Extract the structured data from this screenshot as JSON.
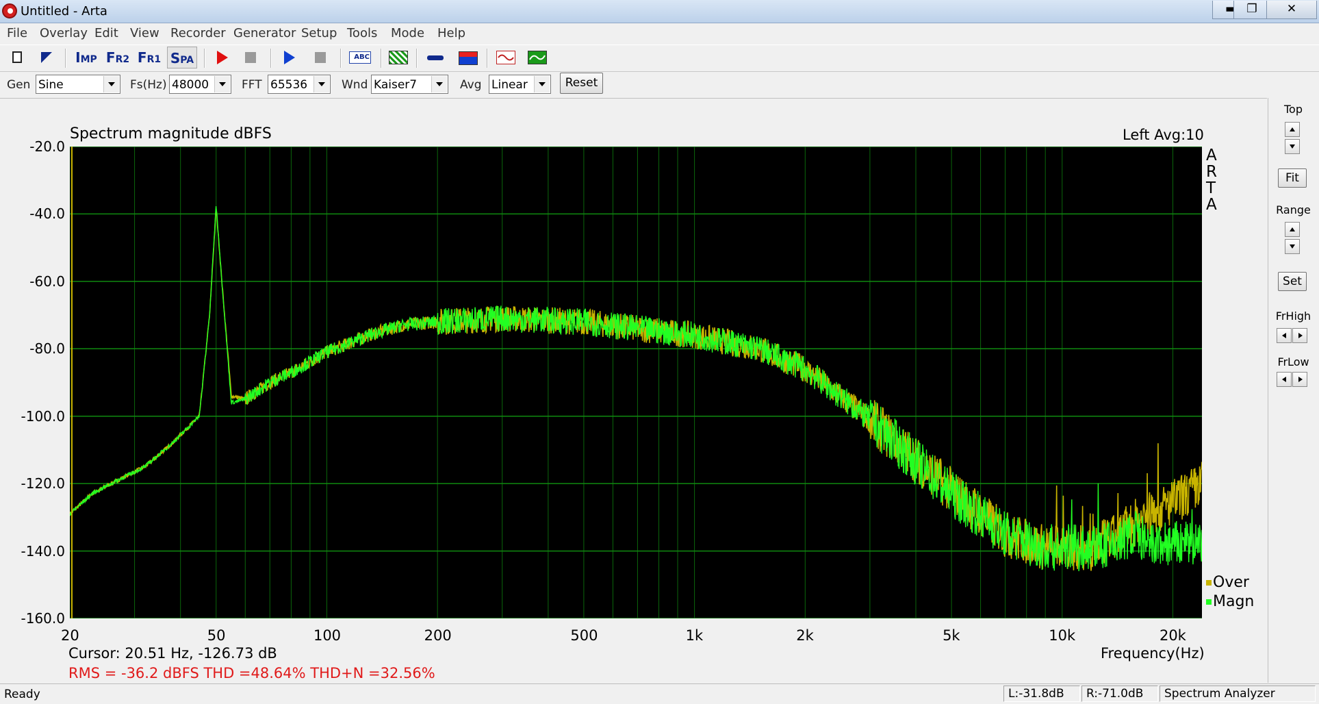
{
  "window": {
    "title": "Untitled - Arta",
    "minimize_glyph": "▬",
    "maximize_glyph": "❐",
    "close_glyph": "✕"
  },
  "menu": [
    "File",
    "Overlay",
    "Edit",
    "View",
    "Recorder",
    "Generator",
    "Setup",
    "Tools",
    "Mode",
    "Help"
  ],
  "toolbar": {
    "imp_label": "I",
    "imp_sub": "MP",
    "fr2_label": "F",
    "fr2_sub": "R2",
    "fr1_label": "F",
    "fr1_sub": "R1",
    "spa_label": "S",
    "spa_sub": "PA",
    "abc_label": "ABC",
    "icons": [
      "new-document-icon",
      "open-arrow-icon",
      "record-icon",
      "stop-icon",
      "play-icon",
      "stop-icon",
      "label-abc-icon",
      "pattern-icon",
      "probe-icon",
      "meter-icon",
      "sine-waveform-icon",
      "green-waveform-icon"
    ]
  },
  "controls": {
    "gen_label": "Gen",
    "gen_value": "Sine",
    "fs_label": "Fs(Hz)",
    "fs_value": "48000",
    "fft_label": "FFT",
    "fft_value": "65536",
    "wnd_label": "Wnd",
    "wnd_value": "Kaiser7",
    "avg_label": "Avg",
    "avg_value": "Linear",
    "reset_label": "Reset"
  },
  "plot": {
    "title": "Spectrum magnitude dBFS",
    "channel_avg": "Left  Avg:10",
    "brand_letters": [
      "A",
      "R",
      "T",
      "A"
    ],
    "x_axis_label": "Frequency(Hz)",
    "cursor_text": "Cursor: 20.51 Hz, -126.73 dB",
    "stats_text": "RMS =  -36.2 dBFS   THD =48.64%   THD+N =32.56%",
    "colors": {
      "background": "#000000",
      "grid": "#0f8a0f",
      "magn": "#22ff22",
      "over": "#c8b400",
      "stats": "#e01a1a"
    }
  },
  "chart_data": {
    "type": "line",
    "title": "Spectrum magnitude dBFS",
    "xlabel": "Frequency(Hz)",
    "ylabel": "",
    "x_scale": "log",
    "xlim": [
      20,
      24000
    ],
    "ylim": [
      -160,
      -20
    ],
    "grid": true,
    "legend_position": "bottom-right",
    "x_ticks": [
      20,
      50,
      100,
      200,
      500,
      1000,
      2000,
      5000,
      10000,
      20000
    ],
    "x_tick_labels": [
      "20",
      "50",
      "100",
      "200",
      "500",
      "1k",
      "2k",
      "5k",
      "10k",
      "20k"
    ],
    "y_ticks": [
      -20,
      -40,
      -60,
      -80,
      -100,
      -120,
      -140,
      -160
    ],
    "y_tick_labels": [
      "-20.0",
      "-40.0",
      "-60.0",
      "-80.0",
      "-100.0",
      "-120.0",
      "-140.0",
      "-160.0"
    ],
    "series": [
      {
        "name": "Over",
        "color": "#c8b400",
        "x": [
          20,
          23,
          27,
          32,
          38,
          45,
          48,
          50,
          52,
          55,
          60,
          70,
          80,
          100,
          130,
          160,
          200,
          300,
          500,
          700,
          1000,
          1500,
          2000,
          3000,
          5000,
          7000,
          9000,
          12000,
          14000,
          16000,
          19000,
          22000,
          24000
        ],
        "y": [
          -129,
          -123,
          -119,
          -115,
          -108,
          -100,
          -70,
          -38,
          -62,
          -94,
          -95,
          -90,
          -87,
          -81,
          -76,
          -73,
          -72,
          -71,
          -72,
          -74,
          -76,
          -80,
          -86,
          -101,
          -122,
          -135,
          -139,
          -139,
          -136,
          -131,
          -127,
          -123,
          -120
        ]
      },
      {
        "name": "Magn",
        "color": "#22ff22",
        "x": [
          20,
          23,
          27,
          32,
          38,
          45,
          48,
          50,
          52,
          55,
          60,
          70,
          80,
          100,
          130,
          160,
          200,
          300,
          500,
          700,
          1000,
          1500,
          2000,
          3000,
          5000,
          7000,
          9000,
          12000,
          14000,
          16000,
          17000,
          19000,
          22000,
          24000
        ],
        "y": [
          -129,
          -123,
          -119,
          -115,
          -108,
          -100,
          -70,
          -37,
          -62,
          -96,
          -95,
          -90,
          -87,
          -81,
          -76,
          -73,
          -72,
          -71,
          -72,
          -74,
          -76,
          -80,
          -86,
          -101,
          -123,
          -135,
          -139,
          -139,
          -138,
          -134,
          -139,
          -138,
          -138,
          -137
        ]
      }
    ]
  },
  "right_panel": {
    "top_label": "Top",
    "fit_label": "Fit",
    "range_label": "Range",
    "set_label": "Set",
    "frhigh_label": "FrHigh",
    "frlow_label": "FrLow"
  },
  "status": {
    "ready": "Ready",
    "left_level": "L:-31.8dB",
    "right_level": "R:-71.0dB",
    "mode": "Spectrum Analyzer"
  }
}
